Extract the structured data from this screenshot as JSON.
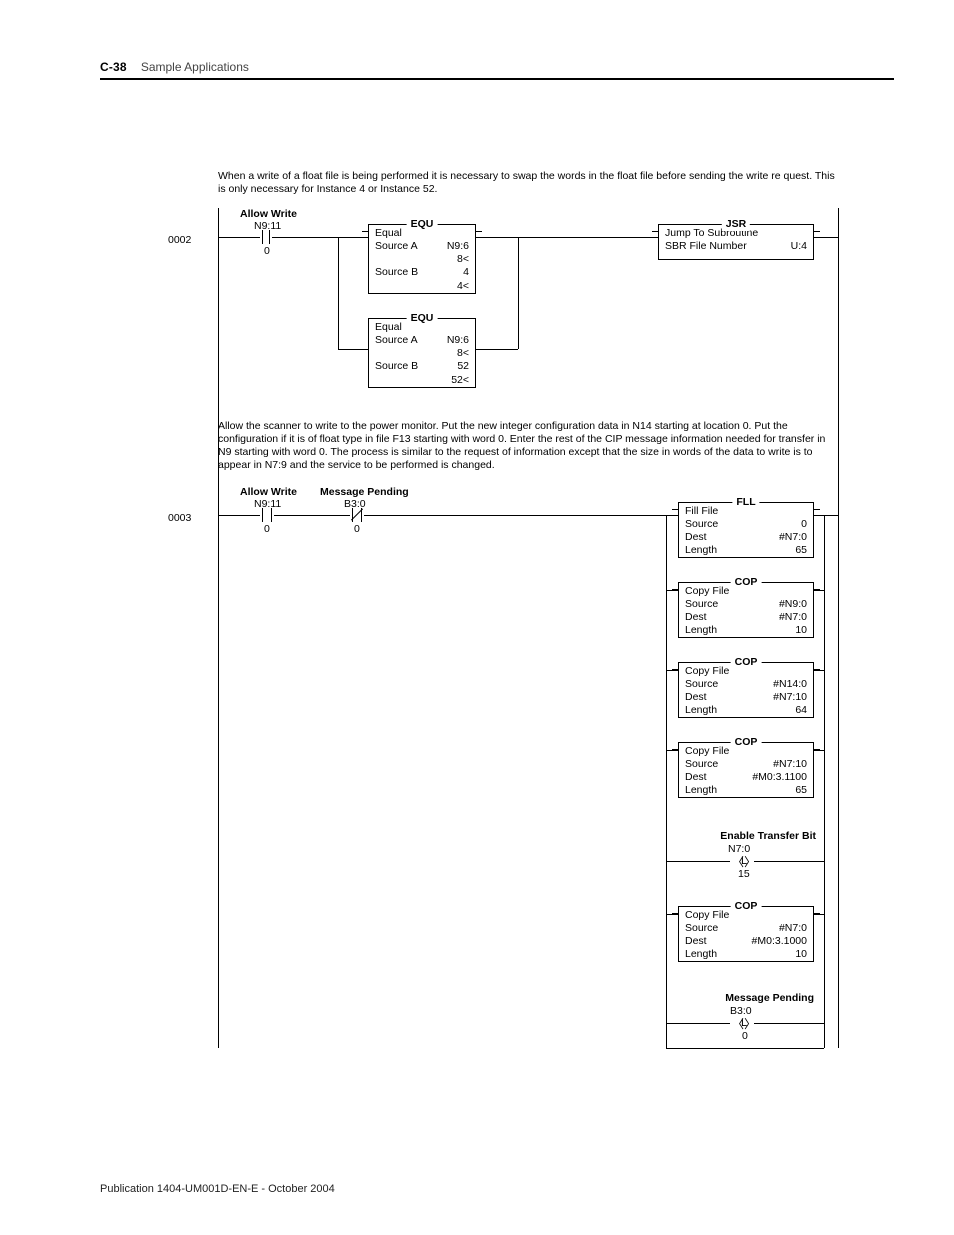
{
  "header": {
    "page_number": "C-38",
    "section": "Sample Applications"
  },
  "footer": "Publication 1404-UM001D-EN-E - October 2004",
  "rung2": {
    "number": "0002",
    "note": "When a write of a float file is being performed it is necessary to swap the words in the float file before sending the write re quest.  This is only necessary for Instance 4 or Instance 52.",
    "contact1": {
      "label": "Allow Write",
      "addr": "N9:11",
      "bit": "0"
    },
    "equ1": {
      "mnemonic": "EQU",
      "name": "Equal",
      "srcA_lbl": "Source A",
      "srcA_val": "N9:6",
      "srcA_sub": "8<",
      "srcB_lbl": "Source B",
      "srcB_val": "4",
      "srcB_sub": "4<"
    },
    "equ2": {
      "mnemonic": "EQU",
      "name": "Equal",
      "srcA_lbl": "Source A",
      "srcA_val": "N9:6",
      "srcA_sub": "8<",
      "srcB_lbl": "Source B",
      "srcB_val": "52",
      "srcB_sub": "52<"
    },
    "jsr": {
      "mnemonic": "JSR",
      "name": "Jump To Subroutine",
      "p_lbl": "SBR File Number",
      "p_val": "U:4"
    }
  },
  "rung3": {
    "number": "0003",
    "note": "Allow the scanner to write to the power monitor. Put the new integer configuration data in N14 starting at location 0.  Put the configuration if it is of float type in file F13 starting with word 0.  Enter the rest of the CIP message information needed for transfer in N9  starting with word 0. The process is similar to the request of information except that the size in words of the data to write is to appear in N7:9 and the service to be performed is changed.",
    "contact1": {
      "label": "Allow Write",
      "addr": "N9:11",
      "bit": "0"
    },
    "contact2": {
      "label": "Message Pending",
      "addr": "B3:0",
      "bit": "0"
    },
    "fll": {
      "m": "FLL",
      "n": "Fill File",
      "src_l": "Source",
      "src_v": "0",
      "dst_l": "Dest",
      "dst_v": "#N7:0",
      "len_l": "Length",
      "len_v": "65"
    },
    "cop1": {
      "m": "COP",
      "n": "Copy File",
      "src_l": "Source",
      "src_v": "#N9:0",
      "dst_l": "Dest",
      "dst_v": "#N7:0",
      "len_l": "Length",
      "len_v": "10"
    },
    "cop2": {
      "m": "COP",
      "n": "Copy File",
      "src_l": "Source",
      "src_v": "#N14:0",
      "dst_l": "Dest",
      "dst_v": "#N7:10",
      "len_l": "Length",
      "len_v": "64"
    },
    "cop3": {
      "m": "COP",
      "n": "Copy File",
      "src_l": "Source",
      "src_v": "#N7:10",
      "dst_l": "Dest",
      "dst_v": "#M0:3.1100",
      "len_l": "Length",
      "len_v": "65"
    },
    "otl1": {
      "label": "Enable Transfer Bit",
      "addr": "N7:0",
      "bit": "15",
      "letter": "L"
    },
    "cop4": {
      "m": "COP",
      "n": "Copy File",
      "src_l": "Source",
      "src_v": "#N7:0",
      "dst_l": "Dest",
      "dst_v": "#M0:3.1000",
      "len_l": "Length",
      "len_v": "10"
    },
    "otl2": {
      "label": "Message Pending",
      "addr": "B3:0",
      "bit": "0",
      "letter": "L"
    }
  }
}
